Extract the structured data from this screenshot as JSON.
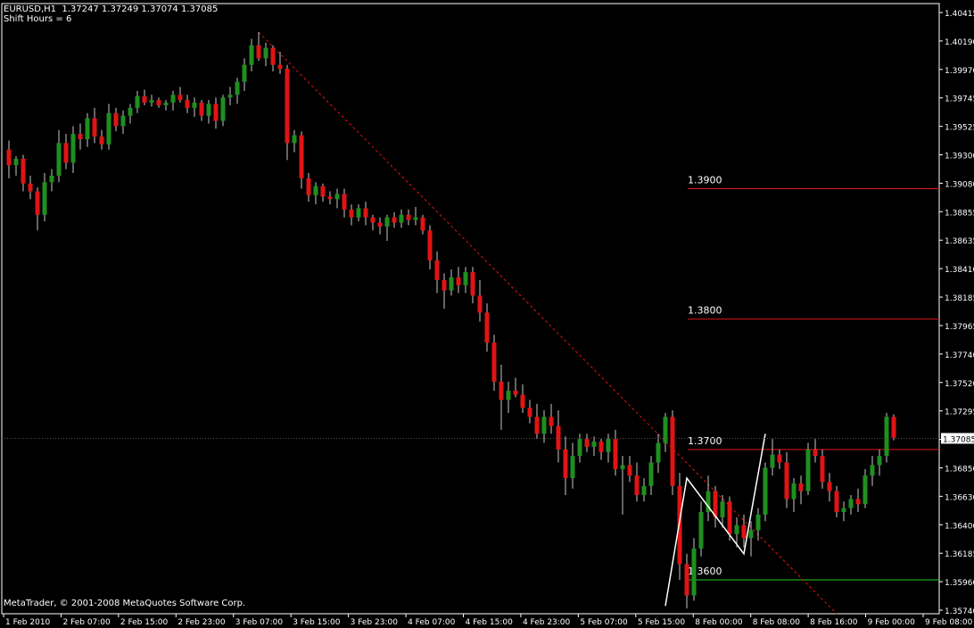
{
  "header": {
    "symbol_line": "EURUSD,H1  1.37247 1.37249 1.37074 1.37085",
    "shift_line": "Shift Hours = 6"
  },
  "footer": {
    "copyright": "MetaTrader, © 2001-2008 MetaQuotes Software Corp."
  },
  "colors": {
    "background": "#000000",
    "axis": "#ffffff",
    "grid": "#2a2a2a",
    "bull": "#1f8f1f",
    "bear": "#e01414",
    "wick": "#c8c8c8",
    "level": "#e01414",
    "support": "#22cc22",
    "trend": "#e01414",
    "zigzag": "#ffffff",
    "price_label_bg": "#ffffff",
    "price_label_fg": "#000000"
  },
  "chart_data": {
    "type": "candlestick",
    "symbol": "EURUSD",
    "timeframe": "H1",
    "ylim": [
      1.3574,
      1.4042
    ],
    "y_ticks": [
      "1.40415",
      "1.40190",
      "1.39970",
      "1.39745",
      "1.39525",
      "1.39300",
      "1.39080",
      "1.38855",
      "1.38635",
      "1.38410",
      "1.38185",
      "1.37965",
      "1.37740",
      "1.37520",
      "1.37295",
      "1.37085",
      "1.36850",
      "1.36630",
      "1.36400",
      "1.36185",
      "1.35960",
      "1.35740"
    ],
    "x_ticks": [
      "1 Feb 2010",
      "2 Feb 07:00",
      "2 Feb 15:00",
      "2 Feb 23:00",
      "3 Feb 07:00",
      "3 Feb 15:00",
      "3 Feb 23:00",
      "4 Feb 07:00",
      "4 Feb 15:00",
      "4 Feb 23:00",
      "5 Feb 07:00",
      "5 Feb 15:00",
      "8 Feb 00:00",
      "8 Feb 08:00",
      "8 Feb 16:00",
      "9 Feb 00:00",
      "9 Feb 08:00"
    ],
    "current_price": "1.37085",
    "horizontal_levels": [
      {
        "label": "1.3900",
        "price": 1.39,
        "color": "red"
      },
      {
        "label": "1.3800",
        "price": 1.38,
        "color": "red"
      },
      {
        "label": "1.3700",
        "price": 1.37,
        "color": "red"
      },
      {
        "label": "1.3600",
        "price": 1.36,
        "color": "green"
      }
    ],
    "trendline": {
      "from": {
        "bar": 35,
        "price": 1.402
      },
      "to": {
        "bar": 116,
        "price": 1.3574
      }
    },
    "zigzag": [
      {
        "bar": 92,
        "price": 1.358
      },
      {
        "bar": 95,
        "price": 1.3678
      },
      {
        "bar": 103,
        "price": 1.362
      },
      {
        "bar": 106,
        "price": 1.3712
      }
    ],
    "candles": [
      [
        1.393,
        1.3937,
        1.3908,
        1.3918
      ],
      [
        1.3918,
        1.3925,
        1.391,
        1.3923
      ],
      [
        1.3923,
        1.3926,
        1.3898,
        1.3904
      ],
      [
        1.3904,
        1.391,
        1.3892,
        1.3898
      ],
      [
        1.3898,
        1.3901,
        1.3868,
        1.388
      ],
      [
        1.388,
        1.3912,
        1.3875,
        1.3905
      ],
      [
        1.3905,
        1.3915,
        1.3898,
        1.391
      ],
      [
        1.391,
        1.3945,
        1.3905,
        1.3935
      ],
      [
        1.3935,
        1.3942,
        1.3915,
        1.392
      ],
      [
        1.392,
        1.3948,
        1.3912,
        1.3942
      ],
      [
        1.3942,
        1.395,
        1.393,
        1.3938
      ],
      [
        1.3938,
        1.3958,
        1.3932,
        1.3954
      ],
      [
        1.3954,
        1.3962,
        1.3935,
        1.394
      ],
      [
        1.394,
        1.3945,
        1.393,
        1.3934
      ],
      [
        1.3934,
        1.3965,
        1.393,
        1.3958
      ],
      [
        1.3958,
        1.3962,
        1.3944,
        1.3948
      ],
      [
        1.3948,
        1.396,
        1.3942,
        1.3956
      ],
      [
        1.3956,
        1.3965,
        1.395,
        1.3962
      ],
      [
        1.3962,
        1.3975,
        1.3958,
        1.3971
      ],
      [
        1.3971,
        1.3976,
        1.3964,
        1.3966
      ],
      [
        1.3966,
        1.3972,
        1.3963,
        1.3968
      ],
      [
        1.3968,
        1.397,
        1.3962,
        1.3964
      ],
      [
        1.3964,
        1.3968,
        1.396,
        1.3966
      ],
      [
        1.3966,
        1.3975,
        1.396,
        1.3972
      ],
      [
        1.3972,
        1.3978,
        1.3966,
        1.3968
      ],
      [
        1.3968,
        1.3972,
        1.3958,
        1.3962
      ],
      [
        1.3962,
        1.397,
        1.3955,
        1.3966
      ],
      [
        1.3966,
        1.3968,
        1.3952,
        1.3956
      ],
      [
        1.3956,
        1.3968,
        1.395,
        1.3965
      ],
      [
        1.3965,
        1.397,
        1.3946,
        1.3952
      ],
      [
        1.3952,
        1.3972,
        1.3948,
        1.397
      ],
      [
        1.397,
        1.3978,
        1.3964,
        1.3972
      ],
      [
        1.3972,
        1.3985,
        1.3965,
        1.3982
      ],
      [
        1.3982,
        1.4,
        1.3975,
        1.3995
      ],
      [
        1.3995,
        1.4015,
        1.399,
        1.401
      ],
      [
        1.401,
        1.402,
        1.3998,
        1.4
      ],
      [
        1.4,
        1.4012,
        1.3994,
        1.4008
      ],
      [
        1.4008,
        1.401,
        1.399,
        1.3995
      ],
      [
        1.3995,
        1.4005,
        1.3988,
        1.3992
      ],
      [
        1.3992,
        1.3995,
        1.3922,
        1.3935
      ],
      [
        1.3935,
        1.3945,
        1.3928,
        1.3941
      ],
      [
        1.3941,
        1.3944,
        1.39,
        1.3908
      ],
      [
        1.3908,
        1.3912,
        1.389,
        1.3895
      ],
      [
        1.3895,
        1.3905,
        1.3888,
        1.3902
      ],
      [
        1.3902,
        1.3904,
        1.389,
        1.3894
      ],
      [
        1.3894,
        1.3898,
        1.3888,
        1.3892
      ],
      [
        1.3892,
        1.39,
        1.3885,
        1.3896
      ],
      [
        1.3896,
        1.39,
        1.3878,
        1.3884
      ],
      [
        1.3884,
        1.3888,
        1.3872,
        1.3878
      ],
      [
        1.3878,
        1.3888,
        1.3875,
        1.3885
      ],
      [
        1.3885,
        1.389,
        1.3872,
        1.3878
      ],
      [
        1.3878,
        1.388,
        1.3868,
        1.3874
      ],
      [
        1.3874,
        1.3878,
        1.3865,
        1.3871
      ],
      [
        1.3871,
        1.388,
        1.386,
        1.3878
      ],
      [
        1.3878,
        1.3882,
        1.387,
        1.3874
      ],
      [
        1.3874,
        1.3884,
        1.387,
        1.388
      ],
      [
        1.388,
        1.3884,
        1.3872,
        1.3876
      ],
      [
        1.3876,
        1.3886,
        1.3872,
        1.3878
      ],
      [
        1.3878,
        1.388,
        1.3865,
        1.3868
      ],
      [
        1.3868,
        1.3872,
        1.3838,
        1.3845
      ],
      [
        1.3845,
        1.3852,
        1.382,
        1.383
      ],
      [
        1.383,
        1.3835,
        1.3808,
        1.3822
      ],
      [
        1.3822,
        1.3838,
        1.3818,
        1.3832
      ],
      [
        1.3832,
        1.384,
        1.382,
        1.3826
      ],
      [
        1.3826,
        1.384,
        1.382,
        1.3836
      ],
      [
        1.3836,
        1.384,
        1.3812,
        1.3818
      ],
      [
        1.3818,
        1.383,
        1.3798,
        1.3805
      ],
      [
        1.3805,
        1.3812,
        1.3775,
        1.3782
      ],
      [
        1.3782,
        1.3788,
        1.3745,
        1.3752
      ],
      [
        1.3752,
        1.3765,
        1.3715,
        1.3738
      ],
      [
        1.3738,
        1.3752,
        1.3728,
        1.3745
      ],
      [
        1.3745,
        1.3755,
        1.374,
        1.3742
      ],
      [
        1.3742,
        1.375,
        1.3728,
        1.3732
      ],
      [
        1.3732,
        1.3738,
        1.372,
        1.3725
      ],
      [
        1.3725,
        1.3735,
        1.3708,
        1.3712
      ],
      [
        1.3712,
        1.373,
        1.3705,
        1.3725
      ],
      [
        1.3725,
        1.3735,
        1.3712,
        1.3718
      ],
      [
        1.3718,
        1.373,
        1.369,
        1.37
      ],
      [
        1.37,
        1.371,
        1.3665,
        1.3678
      ],
      [
        1.3678,
        1.3705,
        1.367,
        1.3695
      ],
      [
        1.3695,
        1.3712,
        1.369,
        1.3708
      ],
      [
        1.3708,
        1.3712,
        1.3698,
        1.3702
      ],
      [
        1.3702,
        1.371,
        1.3695,
        1.3706
      ],
      [
        1.3706,
        1.3708,
        1.3692,
        1.3698
      ],
      [
        1.3698,
        1.3712,
        1.369,
        1.3708
      ],
      [
        1.3708,
        1.3715,
        1.368,
        1.3685
      ],
      [
        1.3685,
        1.3695,
        1.365,
        1.3688
      ],
      [
        1.3688,
        1.3695,
        1.3675,
        1.368
      ],
      [
        1.368,
        1.369,
        1.366,
        1.3665
      ],
      [
        1.3665,
        1.3678,
        1.366,
        1.3672
      ],
      [
        1.3672,
        1.3695,
        1.3665,
        1.369
      ],
      [
        1.369,
        1.3712,
        1.3682,
        1.3705
      ],
      [
        1.3705,
        1.3728,
        1.3698,
        1.3725
      ],
      [
        1.3725,
        1.373,
        1.3665,
        1.3672
      ],
      [
        1.3672,
        1.3682,
        1.36,
        1.3612
      ],
      [
        1.3612,
        1.362,
        1.3578,
        1.3588
      ],
      [
        1.3588,
        1.3632,
        1.3584,
        1.3624
      ],
      [
        1.3624,
        1.366,
        1.3618,
        1.3652
      ],
      [
        1.3652,
        1.368,
        1.3645,
        1.3668
      ],
      [
        1.3668,
        1.3672,
        1.364,
        1.3648
      ],
      [
        1.3648,
        1.3665,
        1.364,
        1.366
      ],
      [
        1.366,
        1.3664,
        1.363,
        1.3635
      ],
      [
        1.3635,
        1.3648,
        1.3625,
        1.3642
      ],
      [
        1.3642,
        1.365,
        1.3625,
        1.3632
      ],
      [
        1.3632,
        1.3645,
        1.3618,
        1.3638
      ],
      [
        1.3638,
        1.3655,
        1.363,
        1.365
      ],
      [
        1.365,
        1.369,
        1.3645,
        1.3686
      ],
      [
        1.3686,
        1.3708,
        1.368,
        1.3696
      ],
      [
        1.3696,
        1.37,
        1.3685,
        1.369
      ],
      [
        1.369,
        1.3698,
        1.3655,
        1.3662
      ],
      [
        1.3662,
        1.3678,
        1.3652,
        1.3674
      ],
      [
        1.3674,
        1.368,
        1.3658,
        1.3668
      ],
      [
        1.3668,
        1.3705,
        1.3665,
        1.37
      ],
      [
        1.37,
        1.3708,
        1.369,
        1.3695
      ],
      [
        1.3695,
        1.37,
        1.367,
        1.3675
      ],
      [
        1.3675,
        1.3682,
        1.366,
        1.3668
      ],
      [
        1.3668,
        1.3672,
        1.3648,
        1.3652
      ],
      [
        1.3652,
        1.366,
        1.3645,
        1.3655
      ],
      [
        1.3655,
        1.3665,
        1.365,
        1.3662
      ],
      [
        1.3662,
        1.367,
        1.3652,
        1.3658
      ],
      [
        1.3658,
        1.3685,
        1.3655,
        1.368
      ],
      [
        1.368,
        1.3695,
        1.3672,
        1.3688
      ],
      [
        1.3688,
        1.37,
        1.368,
        1.3695
      ],
      [
        1.3695,
        1.3728,
        1.369,
        1.3725
      ],
      [
        1.3725,
        1.3727,
        1.3707,
        1.3709
      ]
    ]
  }
}
